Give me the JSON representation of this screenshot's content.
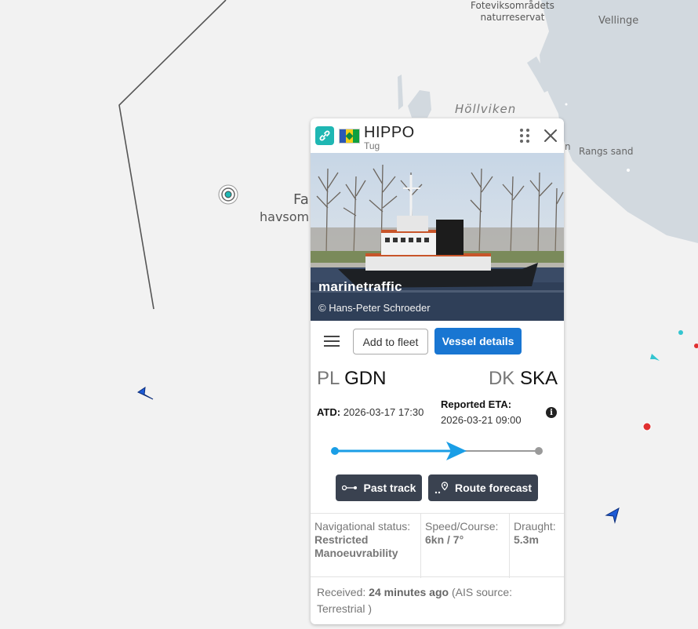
{
  "map": {
    "labels": {
      "foteviks": "Foteviksområdets\nnaturreservat",
      "vellinge": "Vellinge",
      "hollviken": "Höllviken",
      "rangs_sand": "Rangs sand",
      "n_fragment": "n",
      "fa": "Fa",
      "havsom": "havsom"
    },
    "colors": {
      "sea": "#f2f2f2",
      "land": "#d2d9df",
      "route": "#555555",
      "vessel_blue": "#1e5bd6",
      "vessel_red": "#e03030",
      "vessel_cyan": "#33c5d0"
    }
  },
  "vessel": {
    "name": "HIPPO",
    "type": "Tug",
    "flag_icon": "flag-saint-vincent-and-the-grenadines",
    "photo": {
      "watermark": "marinetraffic",
      "credit": "© Hans-Peter Schroeder"
    },
    "actions": {
      "add_fleet": "Add to fleet",
      "details": "Vessel details"
    },
    "route": {
      "from_country": "PL",
      "from_port": "GDN",
      "to_country": "DK",
      "to_port": "SKA",
      "atd_label": "ATD:",
      "atd_value": "2026-03-17 17:30",
      "eta_label": "Reported ETA:",
      "eta_value": "2026-03-21 09:00",
      "progress": 0.6
    },
    "buttons": {
      "past_track": "Past track",
      "route_forecast": "Route forecast"
    },
    "stats": {
      "nav_label": "Navigational status:",
      "nav_value": "Restricted Manoeuvrability",
      "speed_label": "Speed/Course:",
      "speed_value": "6kn / 7°",
      "draught_label": "Draught:",
      "draught_value": "5.3m"
    },
    "received": {
      "label": "Received:",
      "value": "24 minutes ago",
      "source": "(AIS source: Terrestrial )"
    }
  }
}
